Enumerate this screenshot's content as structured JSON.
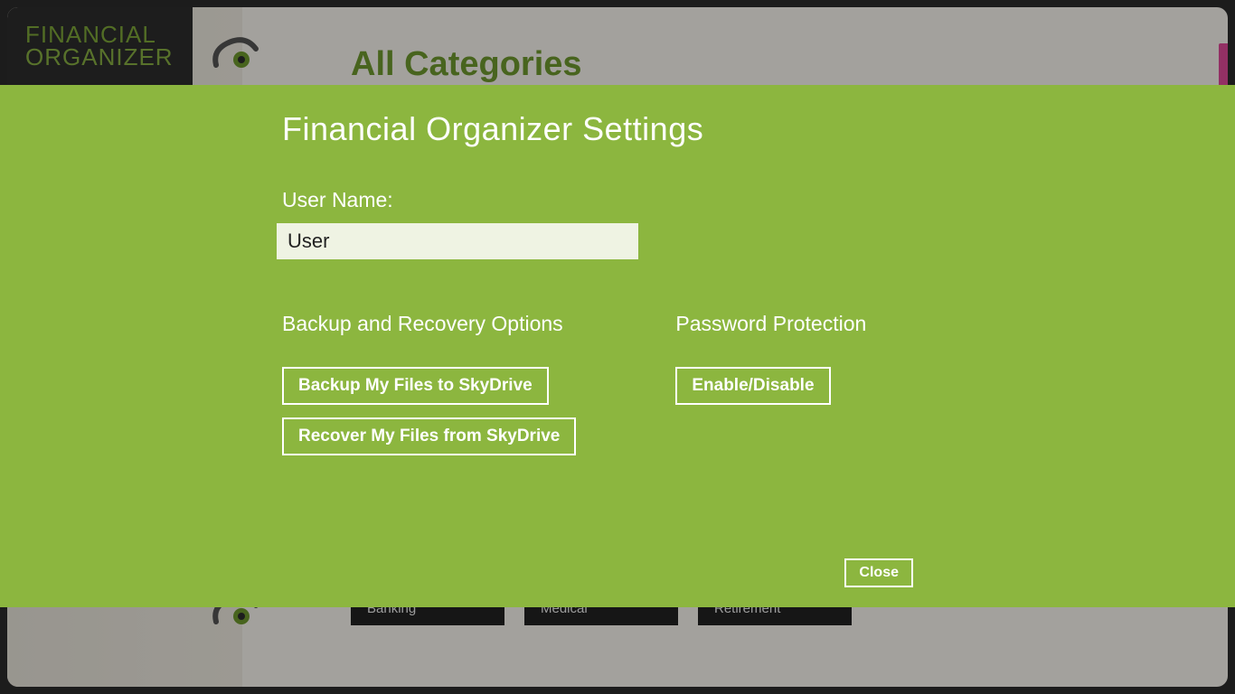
{
  "brand": {
    "line1": "FINANCIAL",
    "line2": "ORGANIZER"
  },
  "background": {
    "page_title": "All Categories",
    "categories": [
      "Banking",
      "Medical",
      "Retirement"
    ]
  },
  "settings": {
    "title": "Financial Organizer Settings",
    "username_label": "User Name:",
    "username_value": "User",
    "backup_section_label": "Backup and Recovery Options",
    "backup_button": "Backup My Files to SkyDrive",
    "recover_button": "Recover My Files from SkyDrive",
    "password_section_label": "Password Protection",
    "password_button": "Enable/Disable",
    "close_button": "Close"
  },
  "colors": {
    "accent": "#8cb63f",
    "brand_bg": "#2d2d2d"
  }
}
